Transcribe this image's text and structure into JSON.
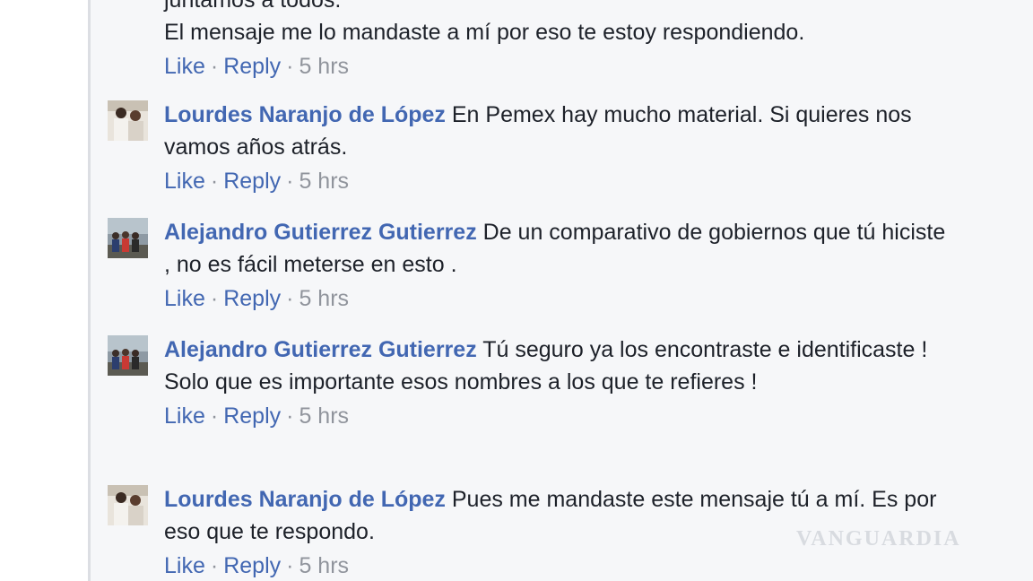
{
  "colors": {
    "background": "#f6f7f9",
    "link": "#4267b2",
    "text": "#1d2129",
    "meta": "#90949c"
  },
  "top_partial": {
    "cut_text": "juntamos a todos.",
    "text": "El mensaje me lo mandaste a mí por eso te estoy respondiendo.",
    "like": "Like",
    "sep1": "·",
    "reply": "Reply",
    "sep2": "·",
    "time": "5 hrs"
  },
  "comments": [
    {
      "author": "Lourdes Naranjo de López",
      "text": " En Pemex hay mucho material. Si quieres nos vamos años atrás.",
      "like": "Like",
      "sep1": "·",
      "reply": "Reply",
      "sep2": "·",
      "time": "5 hrs",
      "avatar": "avatar-lourdes"
    },
    {
      "author": "Alejandro Gutierrez Gutierrez",
      "text": " De un comparativo de gobiernos que tú hiciste , no es fácil meterse en esto .",
      "like": "Like",
      "sep1": "·",
      "reply": "Reply",
      "sep2": "·",
      "time": "5 hrs",
      "avatar": "avatar-alejandro"
    },
    {
      "author": "Alejandro Gutierrez Gutierrez",
      "text": " Tú seguro ya los encontraste e identificaste ! Solo que es importante esos nombres a los que te refieres !",
      "like": "Like",
      "sep1": "·",
      "reply": "Reply",
      "sep2": "·",
      "time": "5 hrs",
      "avatar": "avatar-alejandro"
    },
    {
      "author": "Lourdes Naranjo de López",
      "text": " Pues me mandaste este mensaje tú a mí. Es por eso que te respondo.",
      "like": "Like",
      "sep1": "·",
      "reply": "Reply",
      "sep2": "·",
      "time": "5 hrs",
      "avatar": "avatar-lourdes"
    }
  ],
  "watermark": "VANGUARDIA"
}
